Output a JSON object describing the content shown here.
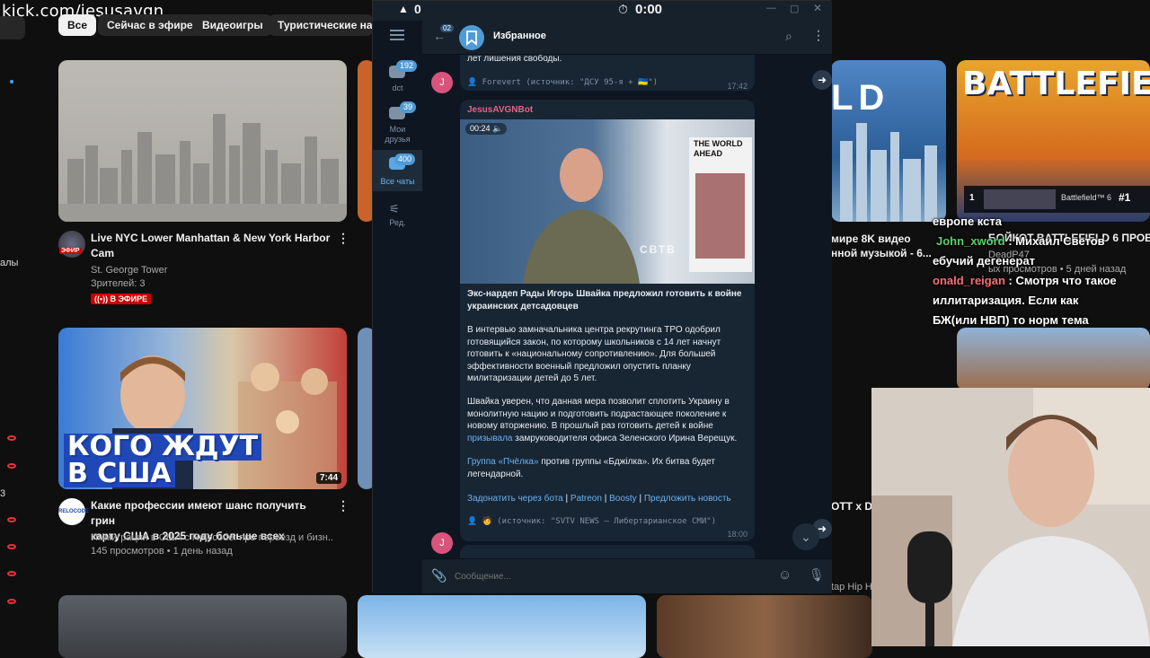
{
  "overlay": {
    "watermark": "kick.com/iesusavgn"
  },
  "youtube": {
    "chips": [
      "Все",
      "Сейчас в эфире",
      "Видеоигры",
      "Туристические напра"
    ],
    "video1": {
      "title_line1": "Live NYC Lower Manhattan & New York Harbor",
      "title_line2": "Cam",
      "channel": "St. George Tower",
      "viewers": "Зрителей: 3",
      "live_badge": "В ЭФИРЕ",
      "avatar_tag": "ЭФИР"
    },
    "video2": {
      "thumb_text_line1": "КОГО ЖДУТ",
      "thumb_text_line2": "В США",
      "duration": "7:44",
      "title_line1": "Какие профессии имеют шанс получить грин",
      "title_line2": "карту США в 2025 году больше всех",
      "channel": "Иммиграция в США с Relocode: про переезд и бизн...",
      "meta": "145 просмотров • 1 день назад",
      "avatar_tag": "RELOCODE"
    },
    "partial_left": {
      "text1": "алы",
      "text2": "3"
    },
    "right_cards": {
      "title_fragment1": "мире 8K видео",
      "title_fragment2": "нной музыкой - 6...",
      "battlefield_thumb": "BATTLEFIE",
      "battlefield_rank": "1",
      "battlefield_game": "Battlefield™ 6",
      "battlefield_num": "#1",
      "battlefield_title": "БОЙКОТ BATTLEFIELD 6 ПРОВА",
      "channel_fragment": "DeadP47",
      "views_fragment": "ых просмотров • 5 дней назад",
      "ld_text": "LD",
      "ott": "OTT x D",
      "tap": "tap Hip H"
    }
  },
  "chat_overlay": [
    {
      "nick": "",
      "text": "европе кста"
    },
    {
      "nick": "John_xword",
      "text": " : Михаил Светов"
    },
    {
      "nick": "",
      "text": "ебучий дегенерат"
    },
    {
      "nick": "onald_reigan",
      "text": " : Смотря что такое"
    },
    {
      "nick": "",
      "text": "иллитаризация. Если как"
    },
    {
      "nick": "",
      "text": "БЖ(или НВП) то норм тема"
    }
  ],
  "telegram": {
    "topbar": {
      "count": "0",
      "timer": "0:00"
    },
    "header": {
      "back_count": "02",
      "title": "Избранное"
    },
    "folders": [
      {
        "label": "dct",
        "badge": "192"
      },
      {
        "label_line1": "Мои",
        "label_line2": "друзья",
        "badge": "39"
      },
      {
        "label": "Все чаты",
        "badge": "400"
      },
      {
        "label": "Ред."
      }
    ],
    "msg_prev": {
      "text": "лет лишения свободы.",
      "source": "Forevert (источник: \"ДСУ 95-я + 🇺🇦\")",
      "time": "17:42"
    },
    "msg": {
      "sender": "JesusAVGNBot",
      "video_time": "00:24",
      "video_caption": "THE WORLD AHEAD",
      "video_watermark": "СВТВ",
      "title": "Экс-нардеп Рады Игорь Швайка предложил готовить к войне украинских детсадовцев",
      "p1": "В интервью замначальника центра рекрутинга ТРО одобрил готовящийся закон, по которому школьников с 14 лет начнут готовить к «национальному сопротивлению». Для большей эффективности военный предложил опустить планку милитаризации детей до 5 лет.",
      "p2_a": "Швайка уверен, что данная мера позволит сплотить Украину в монолитную нацию и подготовить подрастающее поколение к новому вторжению. В прошлый раз готовить детей к войне ",
      "p2_link": "призывала",
      "p2_b": " замруководителя офиса Зеленского Ирина Верещук.",
      "p3_link1": "Группа «Пчёлка»",
      "p3_mid": " против группы «Бджiлка». Их битва будет легендарной.",
      "links": [
        "Задонатить через бота",
        "Patreon",
        "Boosty",
        "Предложить новость"
      ],
      "link_sep": "|",
      "source": "(источник: \"SVTV NEWS — Либертарианское СМИ\")",
      "time": "18:00"
    },
    "avatar_letter": "J",
    "input_placeholder": "Сообщение..."
  },
  "colors": {
    "tg_bg": "#0e1621",
    "tg_panel": "#17212b",
    "accent": "#6ab3f3",
    "live_red": "#cc0000"
  }
}
